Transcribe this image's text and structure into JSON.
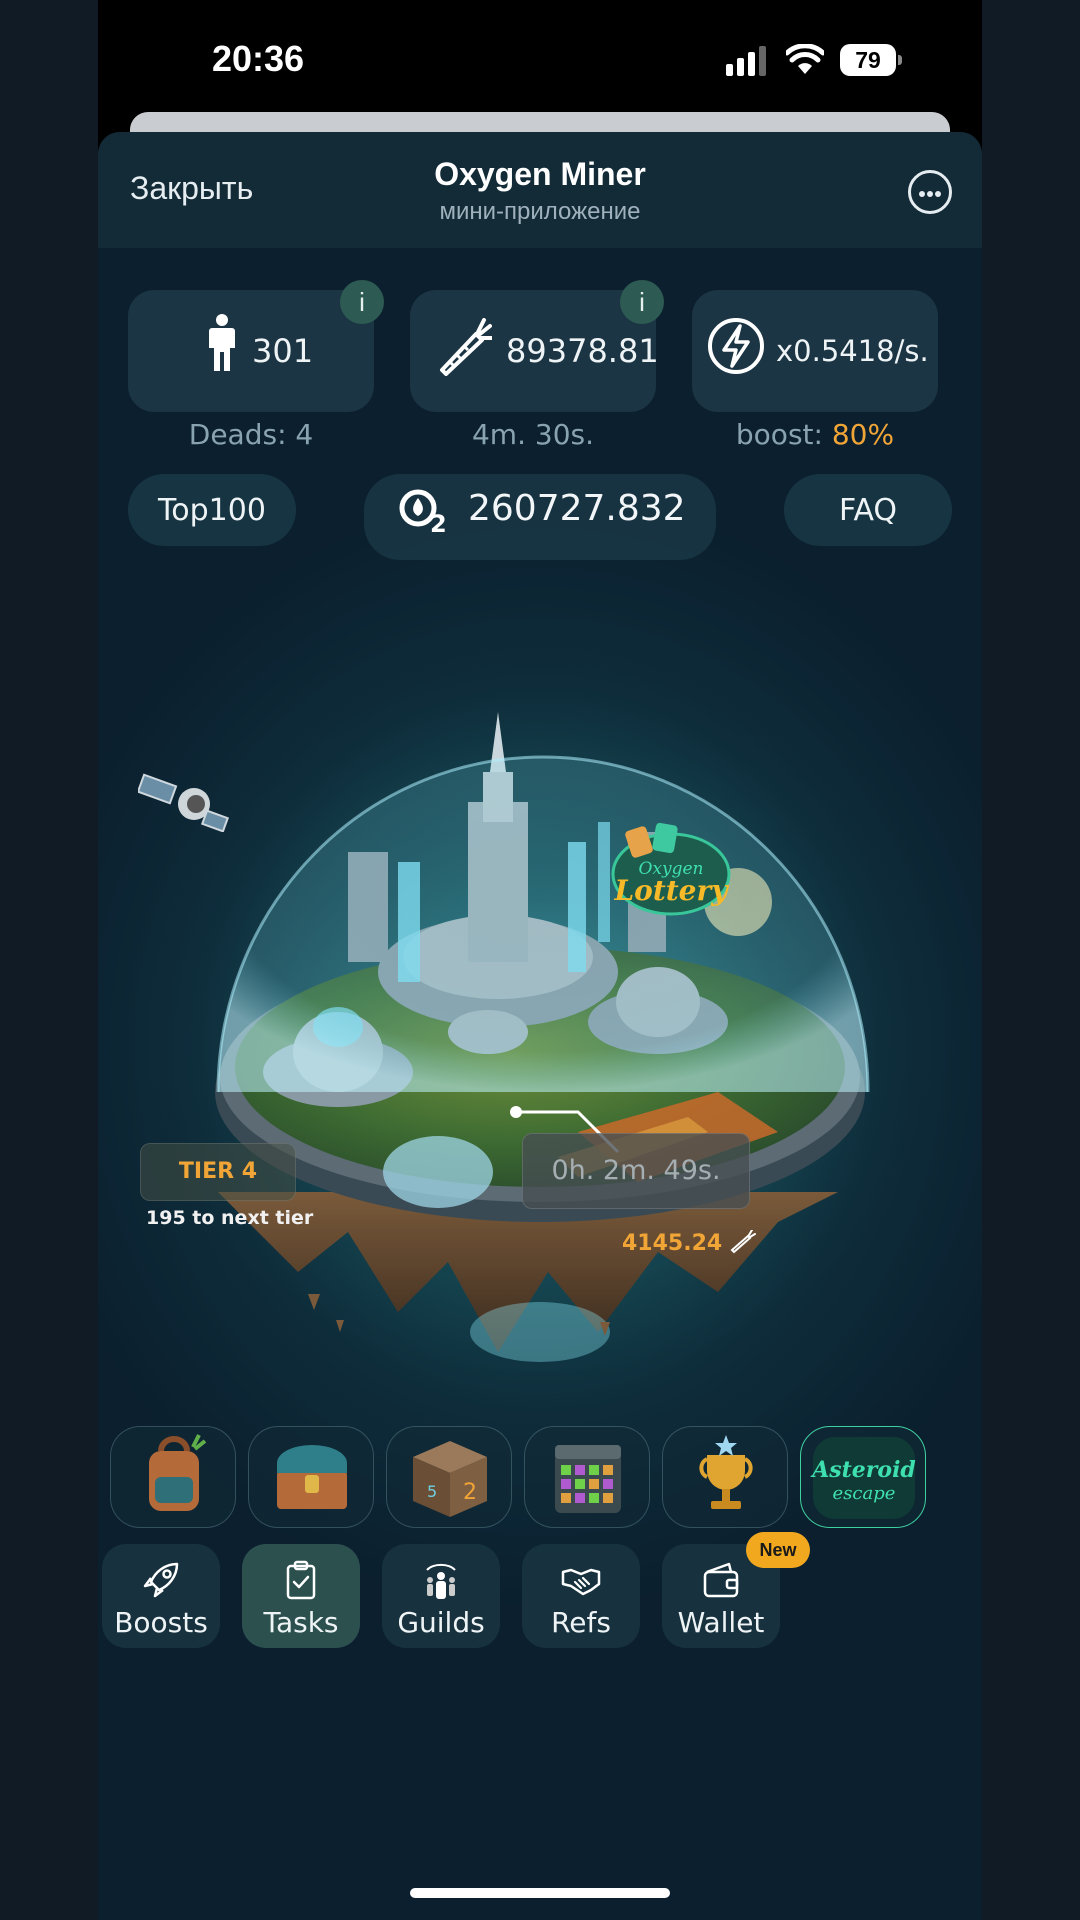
{
  "status_bar": {
    "time": "20:36",
    "battery": "79"
  },
  "header": {
    "close_label": "Закрыть",
    "title": "Oxygen Miner",
    "subtitle": "мини-приложение"
  },
  "stats": {
    "population": {
      "value": "301",
      "caption": "Deads: 4",
      "icon": "person-icon",
      "info": "i"
    },
    "carrots": {
      "value": "89378.81",
      "caption": "4m. 30s.",
      "icon": "carrot-icon",
      "info": "i"
    },
    "rate": {
      "value": "x0.5418/s.",
      "caption_prefix": "boost: ",
      "caption_percent": "80%",
      "icon": "lightning-icon"
    }
  },
  "nav_links": {
    "top100": "Top100",
    "faq": "FAQ"
  },
  "balance": {
    "value": "260727.832",
    "icon": "o2-icon"
  },
  "planet": {
    "tier_label": "TIER 4",
    "next_tier": "195 to next tier",
    "timer": "0h. 2m. 49s.",
    "reward": "4145.24",
    "lottery": "Oxygen Lottery"
  },
  "features": [
    {
      "name": "backpack",
      "icon": "backpack-icon"
    },
    {
      "name": "chest",
      "icon": "treasure-chest-icon"
    },
    {
      "name": "cube",
      "icon": "number-cube-icon"
    },
    {
      "name": "calendar",
      "icon": "calendar-icon"
    },
    {
      "name": "trophy",
      "icon": "trophy-icon"
    },
    {
      "name": "asteroid",
      "icon": "asteroid-escape-icon",
      "label": "Asteroid escape"
    }
  ],
  "bottom_nav": [
    {
      "label": "Boosts",
      "icon": "rocket-icon"
    },
    {
      "label": "Tasks",
      "icon": "clipboard-check-icon",
      "active": true
    },
    {
      "label": "Guilds",
      "icon": "guild-icon"
    },
    {
      "label": "Refs",
      "icon": "handshake-icon"
    },
    {
      "label": "Wallet",
      "icon": "wallet-icon",
      "badge": "New"
    }
  ],
  "colors": {
    "accent": "#f1a536",
    "badge": "#f2a81e",
    "card": "#1e3a48"
  }
}
